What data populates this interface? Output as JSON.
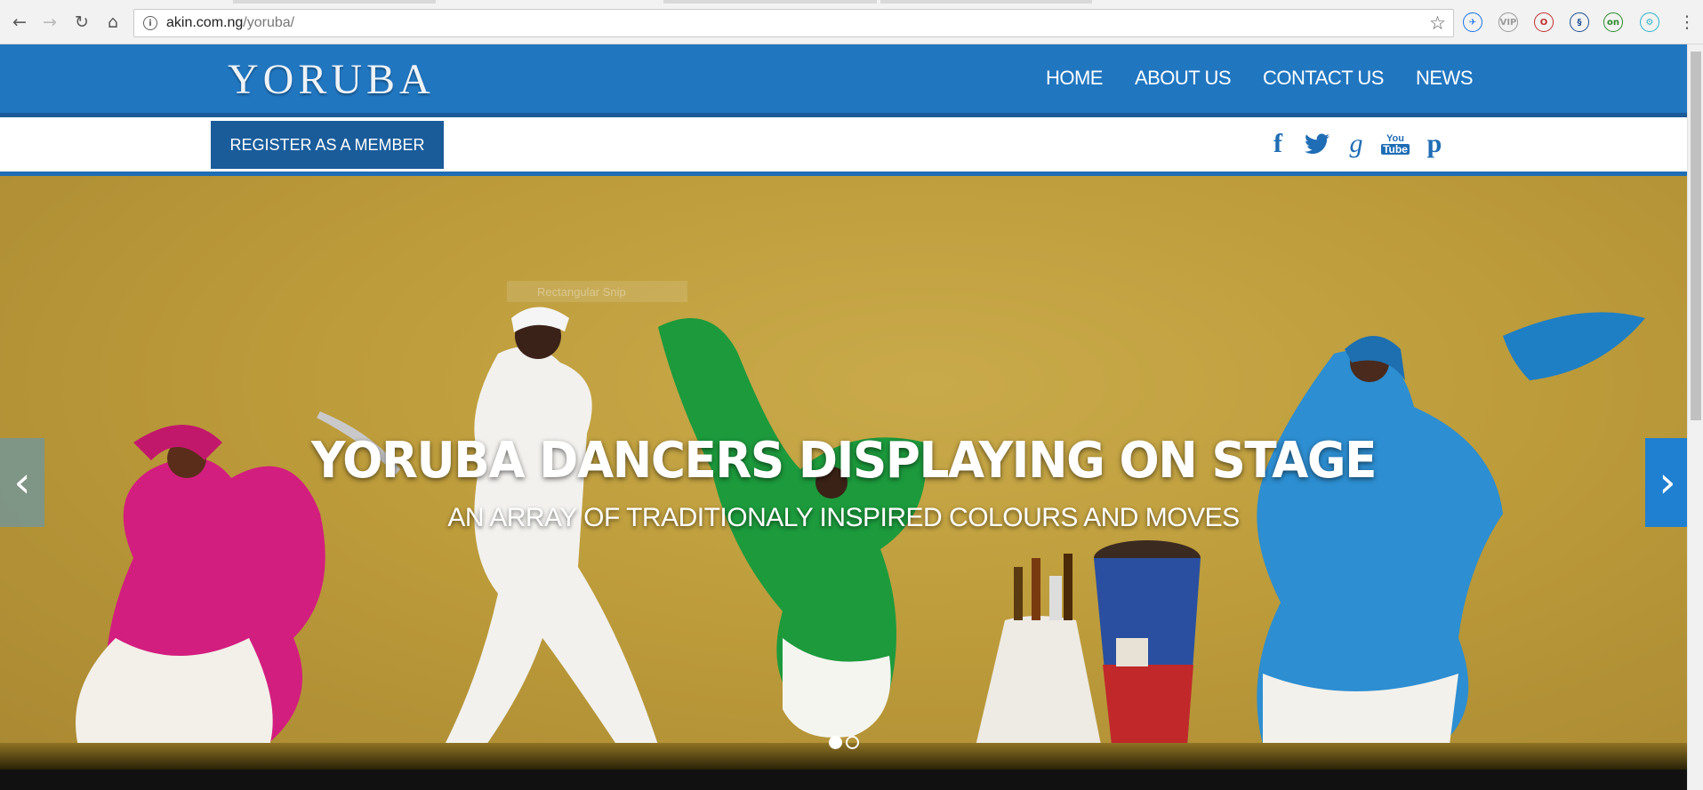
{
  "browser": {
    "url_host": "akin.com.ng",
    "url_path": "/yoruba/",
    "nav": {
      "back": "←",
      "forward": "→",
      "reload": "↻",
      "home": "⌂"
    },
    "star_icon": "star-icon",
    "extensions": [
      {
        "name": "plane-extension-icon",
        "glyph": "✈",
        "color": "#1a73e8"
      },
      {
        "name": "vip-extension-icon",
        "glyph": "VIP",
        "color": "#9a9a9a"
      },
      {
        "name": "opera-extension-icon",
        "glyph": "O",
        "color": "#c0302d"
      },
      {
        "name": "steem-extension-icon",
        "glyph": "§",
        "color": "#1d4f91"
      },
      {
        "name": "vpn-extension-icon",
        "glyph": "on",
        "color": "#2a8a2a"
      },
      {
        "name": "gear-extension-icon",
        "glyph": "⚙",
        "color": "#28b3c9"
      }
    ],
    "menu_icon": "⋮"
  },
  "site": {
    "logo": "YORUBA",
    "nav": [
      "HOME",
      "ABOUT US",
      "CONTACT US",
      "NEWS"
    ],
    "register_label": "REGISTER AS A MEMBER",
    "social": {
      "facebook": "f",
      "google": "g",
      "youtube_top": "You",
      "youtube_bottom": "Tube",
      "pinterest": "p"
    },
    "colors": {
      "header_blue": "#2176c0",
      "button_blue": "#1a5c9a",
      "icon_blue": "#1f6db5"
    }
  },
  "hero": {
    "title": "YORUBA DANCERS DISPLAYING ON STAGE",
    "subtitle": "AN ARRAY OF TRADITIONALY INSPIRED COLOURS AND MOVES",
    "ghost_text": "Rectangular Snip",
    "arrow_left": "‹",
    "arrow_right": "›",
    "slide_count": 2,
    "active_slide": 1
  }
}
